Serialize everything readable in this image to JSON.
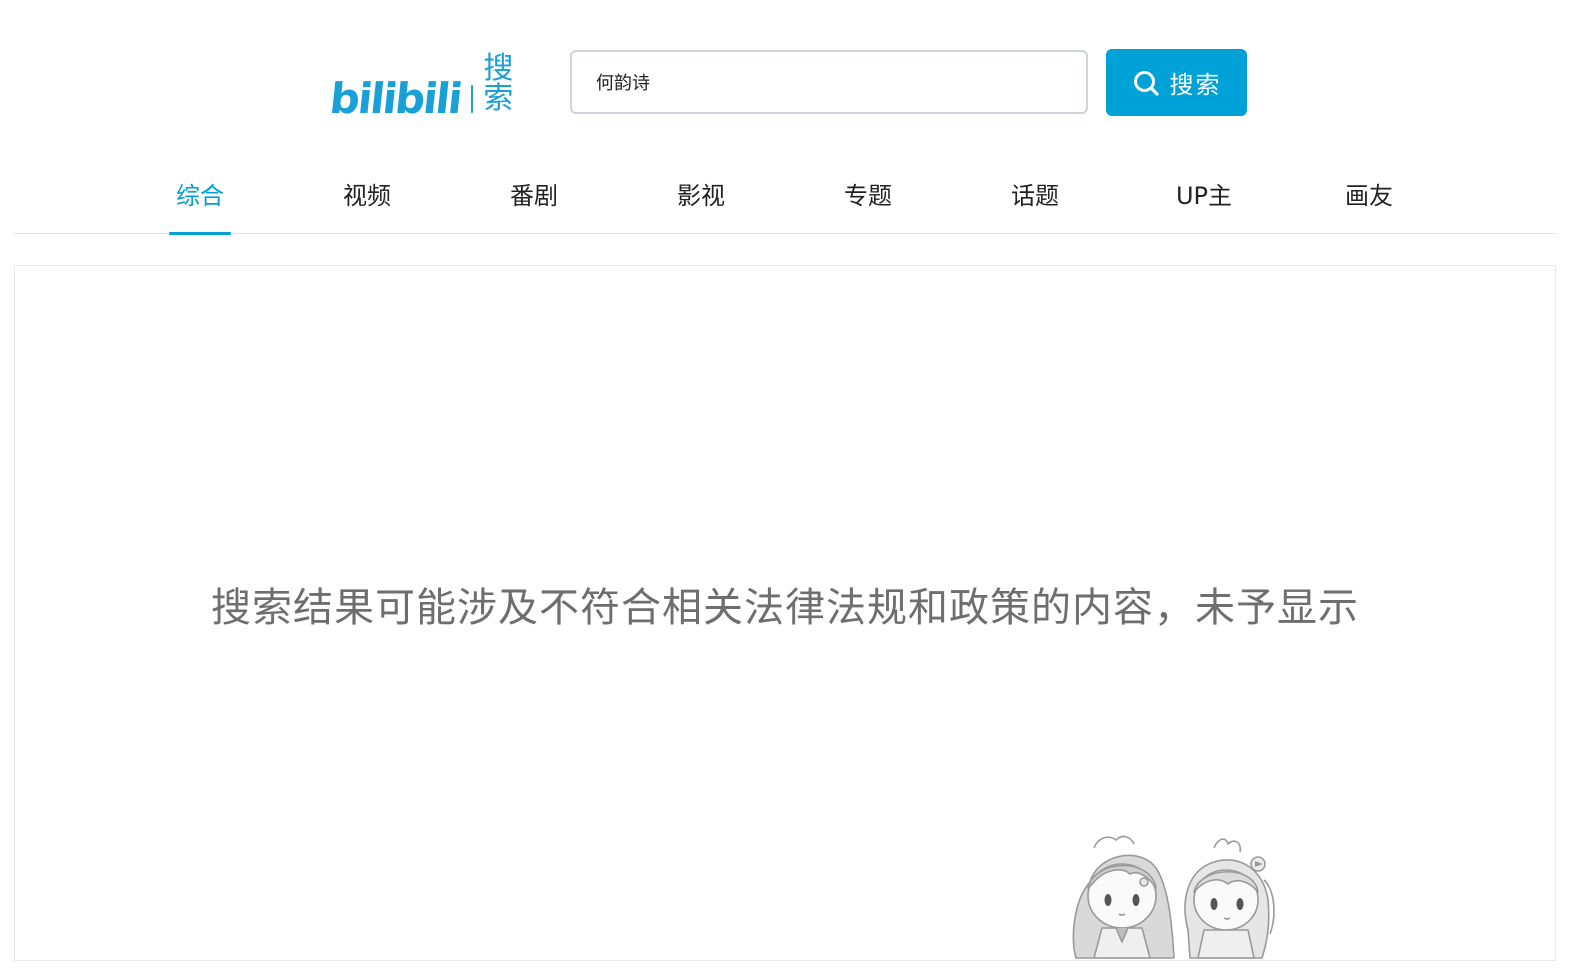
{
  "header": {
    "logo_wordmark": "bilibili",
    "logo_text": "搜索"
  },
  "search": {
    "value": "何韵诗",
    "button_label": "搜索",
    "button_icon": "search-icon"
  },
  "tabs": [
    {
      "label": "综合",
      "active": true
    },
    {
      "label": "视频",
      "active": false
    },
    {
      "label": "番剧",
      "active": false
    },
    {
      "label": "影视",
      "active": false
    },
    {
      "label": "专题",
      "active": false
    },
    {
      "label": "话题",
      "active": false
    },
    {
      "label": "UP主",
      "active": false
    },
    {
      "label": "画友",
      "active": false
    }
  ],
  "content": {
    "notice": "搜索结果可能涉及不符合相关法律法规和政策的内容，未予显示"
  },
  "colors": {
    "accent": "#00a1d6",
    "notice_text": "#6e6e6e",
    "divider": "#e3e5e7"
  }
}
